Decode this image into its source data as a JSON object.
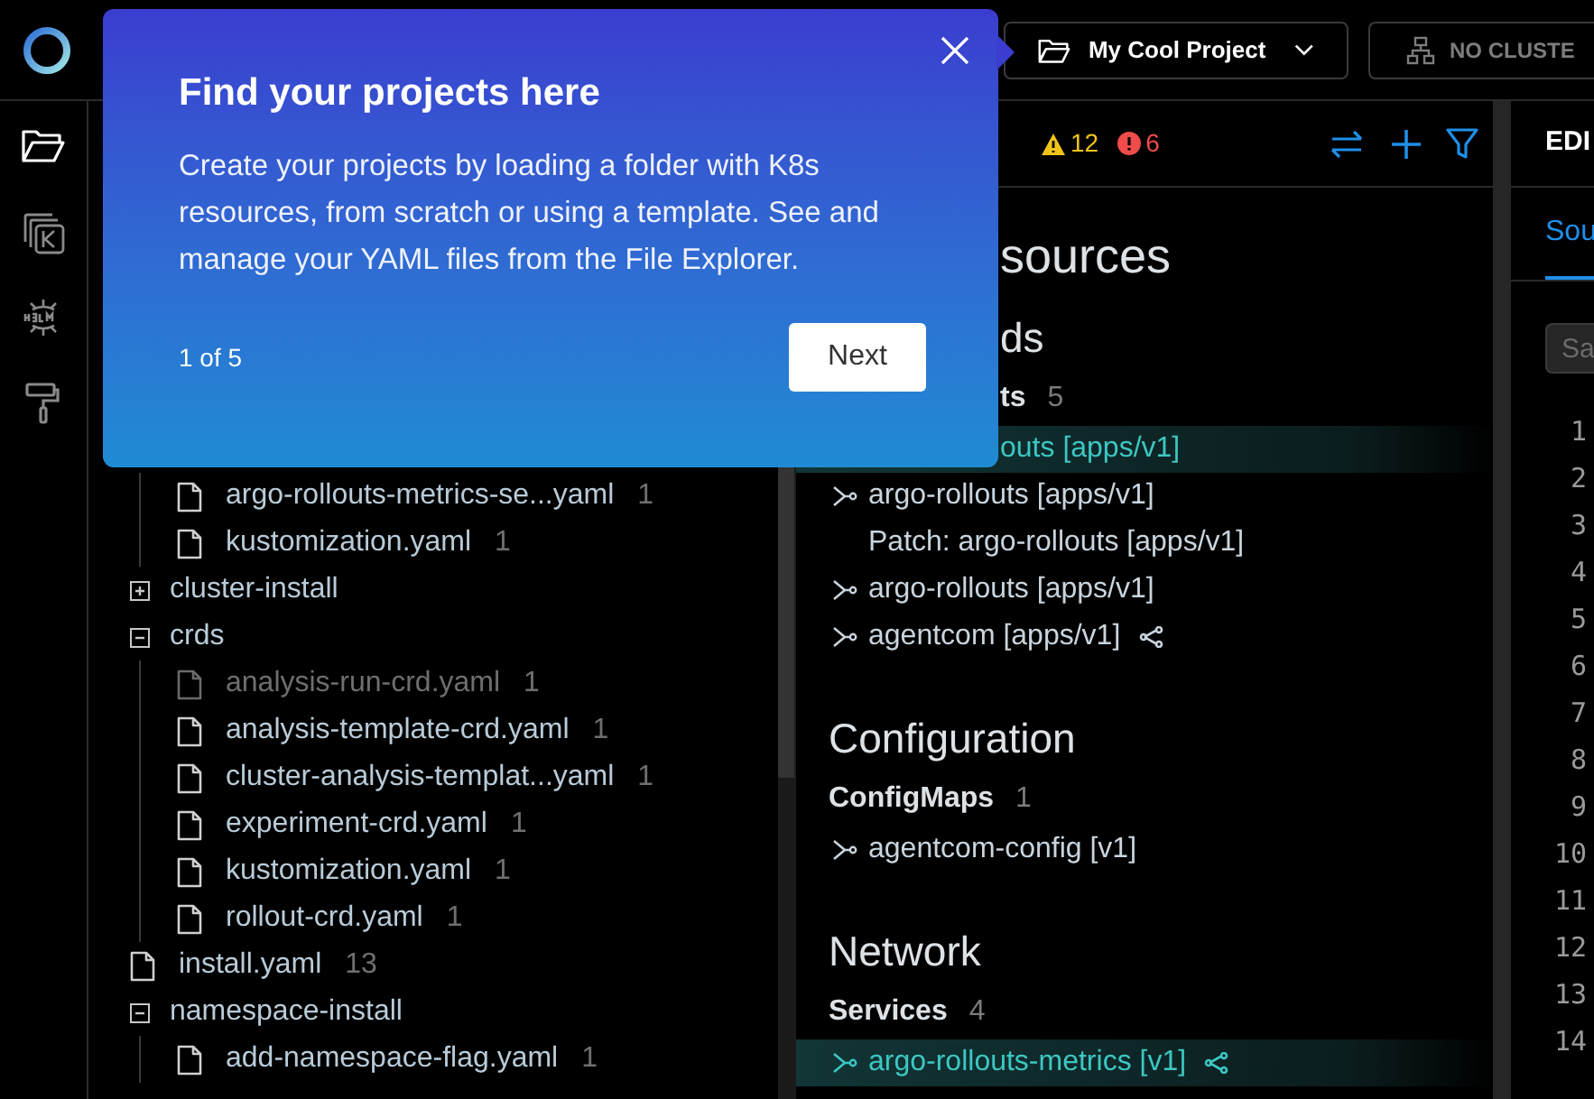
{
  "top_bar": {
    "project": "My Cool Project",
    "cluster": "NO CLUSTE"
  },
  "activity_bar": [
    {
      "kind": "folder",
      "selected": true
    },
    {
      "kind": "kube",
      "selected": false
    },
    {
      "kind": "helm",
      "selected": false
    },
    {
      "kind": "roller",
      "selected": false
    }
  ],
  "file_tree": [
    {
      "kind": "folder",
      "children": [
        {
          "kind": "file",
          "name": "argo-rollouts-metrics-se...yaml",
          "count": "1",
          "disabled": false
        },
        {
          "kind": "file",
          "name": "kustomization.yaml",
          "count": "1",
          "disabled": false
        }
      ]
    },
    {
      "kind": "folder",
      "name": "cluster-install",
      "expanded": false
    },
    {
      "kind": "folder",
      "name": "crds",
      "expanded": true,
      "children": [
        {
          "kind": "file",
          "name": "analysis-run-crd.yaml",
          "count": "1",
          "disabled": true
        },
        {
          "kind": "file",
          "name": "analysis-template-crd.yaml",
          "count": "1",
          "disabled": false
        },
        {
          "kind": "file",
          "name": "cluster-analysis-templat...yaml",
          "count": "1",
          "disabled": false
        },
        {
          "kind": "file",
          "name": "experiment-crd.yaml",
          "count": "1",
          "disabled": false
        },
        {
          "kind": "file",
          "name": "kustomization.yaml",
          "count": "1",
          "disabled": false
        },
        {
          "kind": "file",
          "name": "rollout-crd.yaml",
          "count": "1",
          "disabled": false
        }
      ]
    },
    {
      "kind": "file",
      "name": "install.yaml",
      "count": "13",
      "disabled": false
    },
    {
      "kind": "folder",
      "name": "namespace-install",
      "expanded": true,
      "children": [
        {
          "kind": "file",
          "name": "add-namespace-flag.yaml",
          "count": "1",
          "disabled": false
        }
      ]
    }
  ],
  "navigator": {
    "warnings": "12",
    "errors": "6",
    "items": [
      {
        "kind": "title",
        "text": "sources"
      },
      {
        "kind": "section",
        "text": "ds"
      },
      {
        "kind": "group",
        "text": "ts",
        "count": "5"
      },
      {
        "kind": "resource",
        "text": "outs [apps/v1]",
        "selected": true,
        "linked": false
      },
      {
        "kind": "resource",
        "text": "argo-rollouts [apps/v1]",
        "selected": false,
        "expandable": true,
        "linked": false
      },
      {
        "kind": "resource",
        "text": "Patch: argo-rollouts [apps/v1]",
        "selected": false,
        "expandable": false,
        "linked": false
      },
      {
        "kind": "resource",
        "text": "argo-rollouts [apps/v1]",
        "selected": false,
        "expandable": true,
        "linked": false
      },
      {
        "kind": "resource",
        "text": "agentcom [apps/v1]",
        "selected": false,
        "expandable": true,
        "linked": true
      },
      {
        "kind": "section",
        "text": "Configuration"
      },
      {
        "kind": "group",
        "text": "ConfigMaps",
        "count": "1"
      },
      {
        "kind": "resource",
        "text": "agentcom-config [v1]",
        "selected": false,
        "expandable": true,
        "linked": false
      },
      {
        "kind": "section",
        "text": "Network"
      },
      {
        "kind": "group",
        "text": "Services",
        "count": "4"
      },
      {
        "kind": "resource",
        "text": "argo-rollouts-metrics [v1]",
        "selected": true,
        "expandable": true,
        "linked": true
      }
    ]
  },
  "editor": {
    "title": "EDI",
    "tabs": [
      {
        "label": "Sou",
        "selected": true
      }
    ],
    "search": {
      "placeholder": "Sa"
    },
    "line_numbers": [
      "1",
      "2",
      "3",
      "4",
      "5",
      "6",
      "7",
      "8",
      "9",
      "10",
      "11",
      "12",
      "13",
      "14"
    ]
  },
  "tour_popover": {
    "title": "Find your projects here",
    "body": "Create your projects by loading a folder with K8s resources, from scratch or using a template. See and manage your YAML files from the File Explorer.",
    "step": "1 of 5",
    "next": "Next"
  }
}
